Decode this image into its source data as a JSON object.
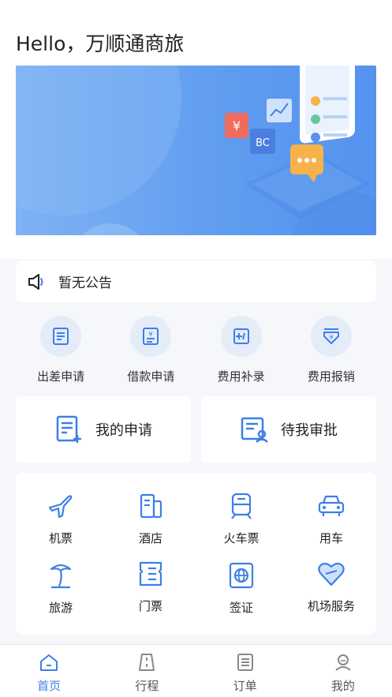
{
  "greeting": "Hello，万顺通商旅",
  "notice": {
    "text": "暂无公告"
  },
  "quick_actions": [
    {
      "label": "出差申请",
      "icon": "document-icon"
    },
    {
      "label": "借款申请",
      "icon": "yen-bill-icon"
    },
    {
      "label": "费用补录",
      "icon": "add-entry-icon"
    },
    {
      "label": "费用报销",
      "icon": "reimburse-icon"
    }
  ],
  "cards": [
    {
      "label": "我的申请",
      "icon": "add-document-icon"
    },
    {
      "label": "待我审批",
      "icon": "approval-icon"
    }
  ],
  "services": [
    {
      "label": "机票",
      "icon": "plane-icon"
    },
    {
      "label": "酒店",
      "icon": "hotel-icon"
    },
    {
      "label": "火车票",
      "icon": "train-icon"
    },
    {
      "label": "用车",
      "icon": "car-icon"
    },
    {
      "label": "旅游",
      "icon": "palm-tree-icon"
    },
    {
      "label": "门票",
      "icon": "ticket-icon"
    },
    {
      "label": "签证",
      "icon": "visa-icon"
    },
    {
      "label": "机场服务",
      "icon": "heart-icon"
    }
  ],
  "tabs": [
    {
      "label": "首页",
      "icon": "home-icon",
      "active": true
    },
    {
      "label": "行程",
      "icon": "road-icon",
      "active": false
    },
    {
      "label": "订单",
      "icon": "list-icon",
      "active": false
    },
    {
      "label": "我的",
      "icon": "user-icon",
      "active": false
    }
  ],
  "colors": {
    "accent": "#3d7fe8",
    "banner": "#5e9cf0",
    "icon_bg": "#e4ecf8",
    "page_bg": "#f5f7fa"
  }
}
